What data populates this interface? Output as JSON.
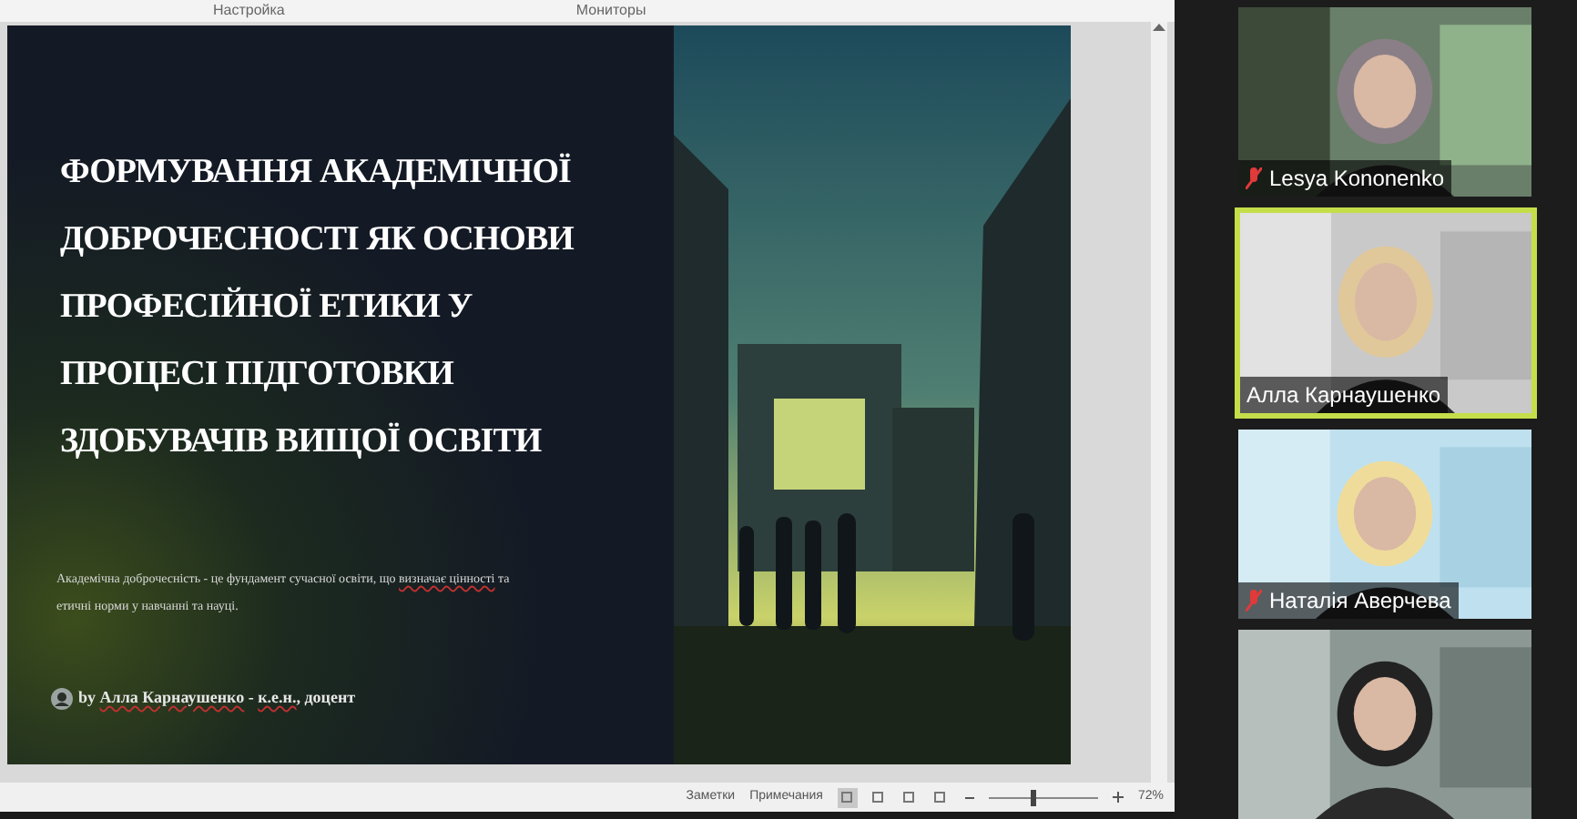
{
  "ribbon": {
    "groups": [
      "Настройка",
      "Мониторы"
    ]
  },
  "slide": {
    "title_lines": [
      "ФОРМУВАННЯ АКАДЕМІЧНОЇ",
      "ДОБРОЧЕСНОСТІ ЯК ОСНОВИ",
      "ПРОФЕСІЙНОЇ ЕТИКИ У",
      "ПРОЦЕСІ ПІДГОТОВКИ",
      "ЗДОБУВАЧІВ ВИЩОЇ ОСВІТИ"
    ],
    "subtitle": [
      {
        "text": "Академічна доброчесність - це фундамент сучасної освіти, що ",
        "flagged": false
      },
      {
        "text": "визначає цінності",
        "flagged": true
      },
      {
        "text": " та етичні норми у навчанні та науці.",
        "flagged": false
      }
    ],
    "byline": [
      {
        "text": "by ",
        "flagged": false
      },
      {
        "text": "Алла Карнаушенко",
        "flagged": true
      },
      {
        "text": " - ",
        "flagged": false
      },
      {
        "text": "к.е.н.",
        "flagged": true
      },
      {
        "text": ", доцент",
        "flagged": false
      }
    ]
  },
  "status_bar": {
    "notes": "Заметки",
    "comments": "Примечания",
    "views": [
      {
        "selected": true
      },
      {
        "selected": false
      },
      {
        "selected": false
      },
      {
        "selected": false
      }
    ],
    "zoom": {
      "level": 0.4,
      "reading": "72%"
    }
  },
  "participants": [
    {
      "name": "Lesya Kononenko",
      "muted": true,
      "active": false
    },
    {
      "name": "Алла Карнаушенко",
      "muted": false,
      "active": true
    },
    {
      "name": "Наталія Аверчева",
      "muted": true,
      "active": false
    },
    {
      "active": false
    }
  ]
}
